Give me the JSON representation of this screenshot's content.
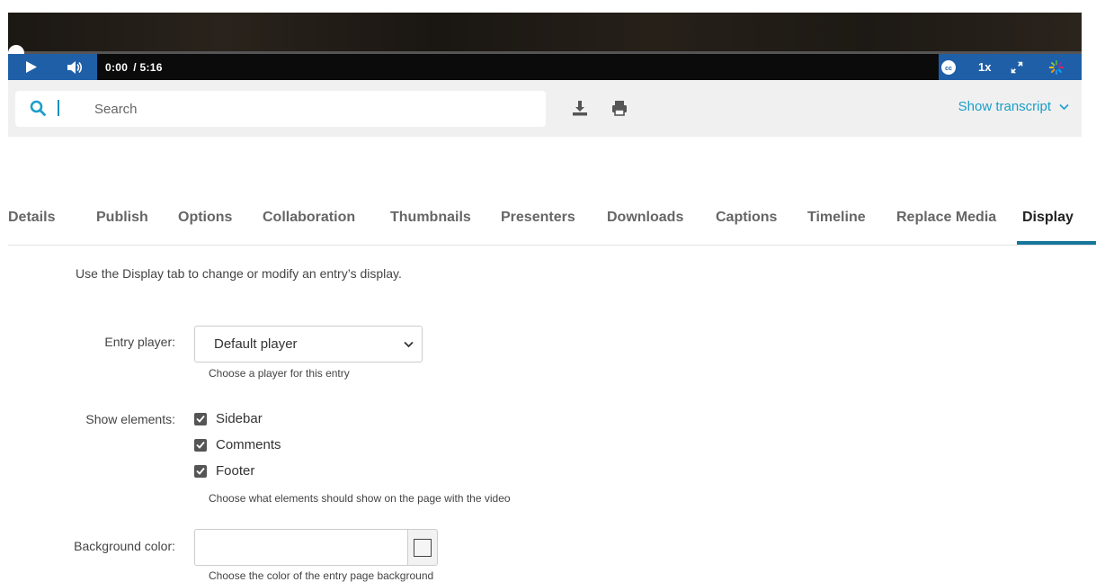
{
  "player": {
    "current_time": "0:00",
    "duration": "/ 5:16",
    "speed": "1x",
    "progress": 0
  },
  "transcript_bar": {
    "search_placeholder": "Search",
    "show_transcript": "Show transcript"
  },
  "tabs": [
    {
      "label": "Details"
    },
    {
      "label": "Publish"
    },
    {
      "label": "Options"
    },
    {
      "label": "Collaboration"
    },
    {
      "label": "Thumbnails"
    },
    {
      "label": "Presenters"
    },
    {
      "label": "Downloads"
    },
    {
      "label": "Captions"
    },
    {
      "label": "Timeline"
    },
    {
      "label": "Replace Media"
    },
    {
      "label": "Display",
      "active": true
    }
  ],
  "display": {
    "description": "Use the Display tab to change or modify an entry’s display.",
    "entry_player_label": "Entry player:",
    "entry_player_value": "Default player",
    "entry_player_help": "Choose a player for this entry",
    "show_elements_label": "Show elements:",
    "elements": [
      {
        "label": "Sidebar",
        "checked": true
      },
      {
        "label": "Comments",
        "checked": true
      },
      {
        "label": "Footer",
        "checked": true
      }
    ],
    "elements_help": "Choose what elements should show on the page with the video",
    "background_label": "Background color:",
    "background_value": "",
    "background_help": "Choose the color of the entry page background"
  },
  "colors": {
    "accent": "#1a9ec9",
    "tab_underline": "#16769b",
    "player_bar": "#1f5fa8"
  }
}
